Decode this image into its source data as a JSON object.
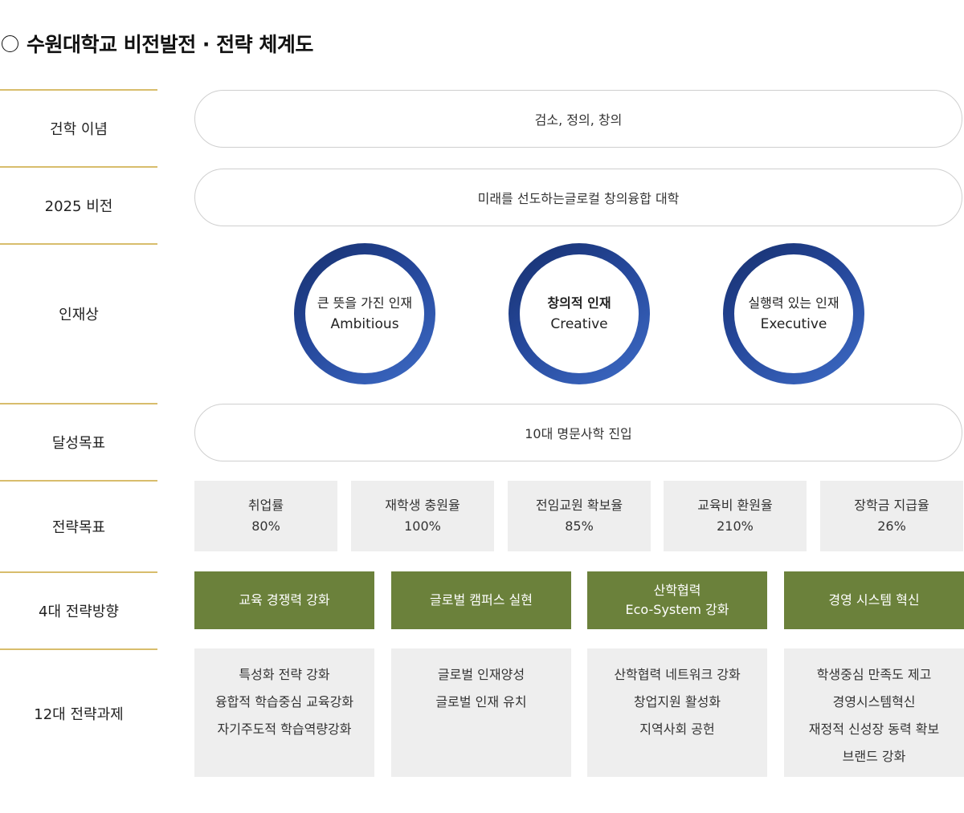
{
  "title": "수원대학교 비전발전 · 전략 체계도",
  "rows": {
    "philosophy": {
      "label": "건학 이념",
      "value": "검소, 정의, 창의"
    },
    "vision": {
      "label": "2025 비전",
      "value": "미래를 선도하는글로컬 창의융합 대학"
    },
    "talent": {
      "label": "인재상",
      "items": [
        {
          "ko": "큰 뜻을 가진 인재",
          "en": "Ambitious"
        },
        {
          "ko": "창의적 인재",
          "en": "Creative"
        },
        {
          "ko": "실행력 있는 인재",
          "en": "Executive"
        }
      ]
    },
    "goal": {
      "label": "달성목표",
      "value": "10대 명문사학 진입"
    },
    "strategic_goals": {
      "label": "전략목표",
      "items": [
        {
          "name": "취업률",
          "value": "80%"
        },
        {
          "name": "재학생 충원율",
          "value": "100%"
        },
        {
          "name": "전임교원 확보율",
          "value": "85%"
        },
        {
          "name": "교육비 환원율",
          "value": "210%"
        },
        {
          "name": "장학금 지급율",
          "value": "26%"
        }
      ]
    },
    "directions": {
      "label": "4대 전략방향",
      "items": [
        {
          "line1": "교육 경쟁력 강화",
          "line2": ""
        },
        {
          "line1": "글로벌 캠퍼스 실현",
          "line2": ""
        },
        {
          "line1": "산학협력",
          "line2": "Eco-System 강화"
        },
        {
          "line1": "경영 시스템 혁신",
          "line2": ""
        }
      ]
    },
    "tasks": {
      "label": "12대 전략과제",
      "groups": [
        [
          "특성화 전략 강화",
          "융합적 학습중심 교육강화",
          "자기주도적 학습역량강화"
        ],
        [
          "글로벌 인재양성",
          "글로벌 인재 유치"
        ],
        [
          "산학협력 네트워크 강화",
          "창업지원 활성화",
          "지역사회 공헌"
        ],
        [
          "학생중심 만족도 제고",
          "경영시스템혁신",
          "재정적 신성장 동력 확보",
          "브랜드 강화"
        ]
      ]
    }
  },
  "colors": {
    "divider": "#d8bd6c",
    "ring": "#2a4da0",
    "direction_bg": "#6b813b",
    "box_bg": "#eeeeee"
  }
}
